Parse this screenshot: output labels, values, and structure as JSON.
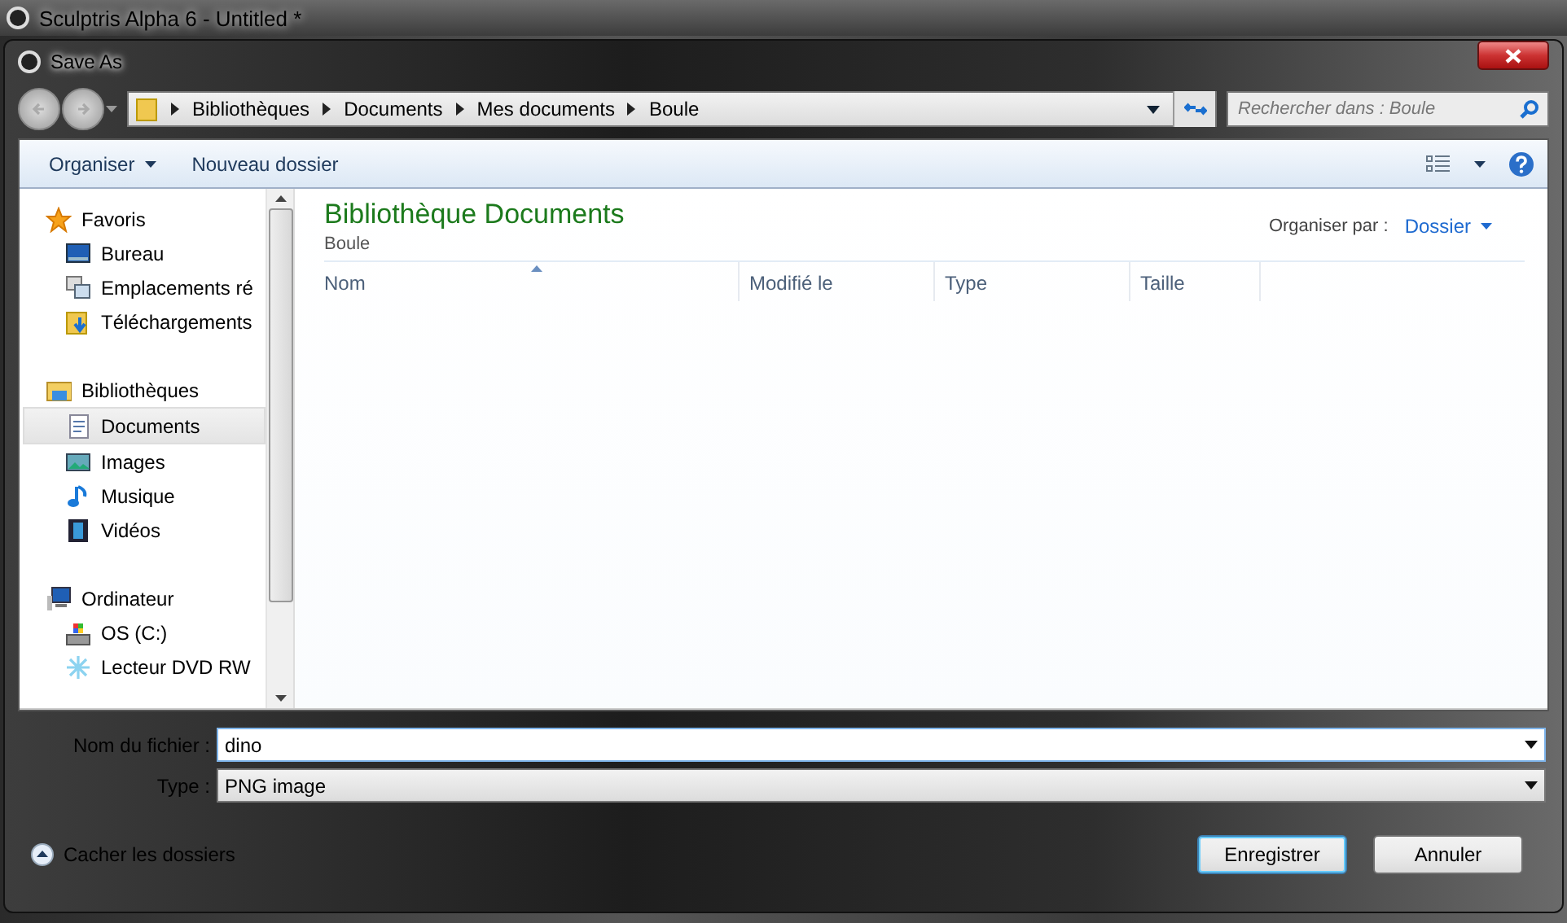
{
  "app_window": {
    "title": "Sculptris Alpha 6 - Untitled *"
  },
  "dialog": {
    "title": "Save As"
  },
  "breadcrumb": [
    "Bibliothèques",
    "Documents",
    "Mes documents",
    "Boule"
  ],
  "search": {
    "placeholder": "Rechercher dans : Boule"
  },
  "toolbar": {
    "organize": "Organiser",
    "new_folder": "Nouveau dossier"
  },
  "sidebar": {
    "groups": [
      {
        "label": "Favoris",
        "kind": "star",
        "children": [
          {
            "label": "Bureau",
            "kind": "desktop",
            "selected": false
          },
          {
            "label": "Emplacements ré",
            "kind": "network",
            "selected": false
          },
          {
            "label": "Téléchargements",
            "kind": "download",
            "selected": false
          }
        ]
      },
      {
        "label": "Bibliothèques",
        "kind": "library",
        "children": [
          {
            "label": "Documents",
            "kind": "document",
            "selected": true
          },
          {
            "label": "Images",
            "kind": "picture",
            "selected": false
          },
          {
            "label": "Musique",
            "kind": "music",
            "selected": false
          },
          {
            "label": "Vidéos",
            "kind": "video",
            "selected": false
          }
        ]
      },
      {
        "label": "Ordinateur",
        "kind": "computer",
        "children": [
          {
            "label": "OS (C:)",
            "kind": "drive",
            "selected": false
          },
          {
            "label": "Lecteur DVD RW",
            "kind": "disc",
            "selected": false
          }
        ]
      }
    ]
  },
  "content": {
    "title": "Bibliothèque Documents",
    "subtitle": "Boule",
    "arrange_label": "Organiser par :",
    "arrange_value": "Dossier",
    "columns": [
      "Nom",
      "Modifié le",
      "Type",
      "Taille"
    ]
  },
  "filename": {
    "label": "Nom du fichier :",
    "value": "dino"
  },
  "filetype": {
    "label": "Type :",
    "value": "PNG image"
  },
  "hide_folders": "Cacher les dossiers",
  "buttons": [
    {
      "label": "Enregistrer",
      "default": true
    },
    {
      "label": "Annuler",
      "default": false
    }
  ]
}
